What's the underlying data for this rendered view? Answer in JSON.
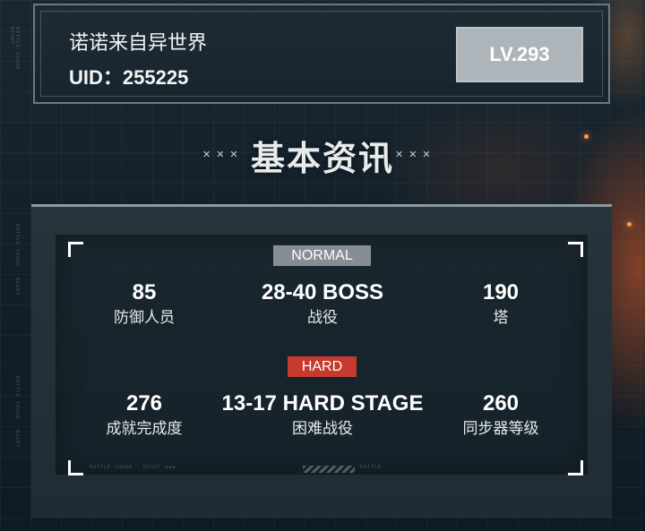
{
  "profile": {
    "name": "诺诺来自异世界",
    "uid": "UID：255225",
    "level": "LV.293"
  },
  "section": {
    "title": "基本资讯"
  },
  "normal": {
    "tag": "NORMAL",
    "stats": [
      {
        "value": "85",
        "label": "防御人员"
      },
      {
        "value": "28-40 BOSS",
        "label": "战役"
      },
      {
        "value": "190",
        "label": "塔"
      }
    ]
  },
  "hard": {
    "tag": "HARD",
    "stats": [
      {
        "value": "276",
        "label": "成就完成度"
      },
      {
        "value": "13-17 HARD STAGE",
        "label": "困难战役"
      },
      {
        "value": "260",
        "label": "同步器等级"
      }
    ]
  },
  "colors": {
    "normal_tag": "#878e93",
    "hard_tag": "#c53a2d",
    "level_badge": "#adb5ba"
  },
  "icons": {
    "decorations": [
      "x-mark-icon",
      "corner-bracket-icon"
    ]
  }
}
